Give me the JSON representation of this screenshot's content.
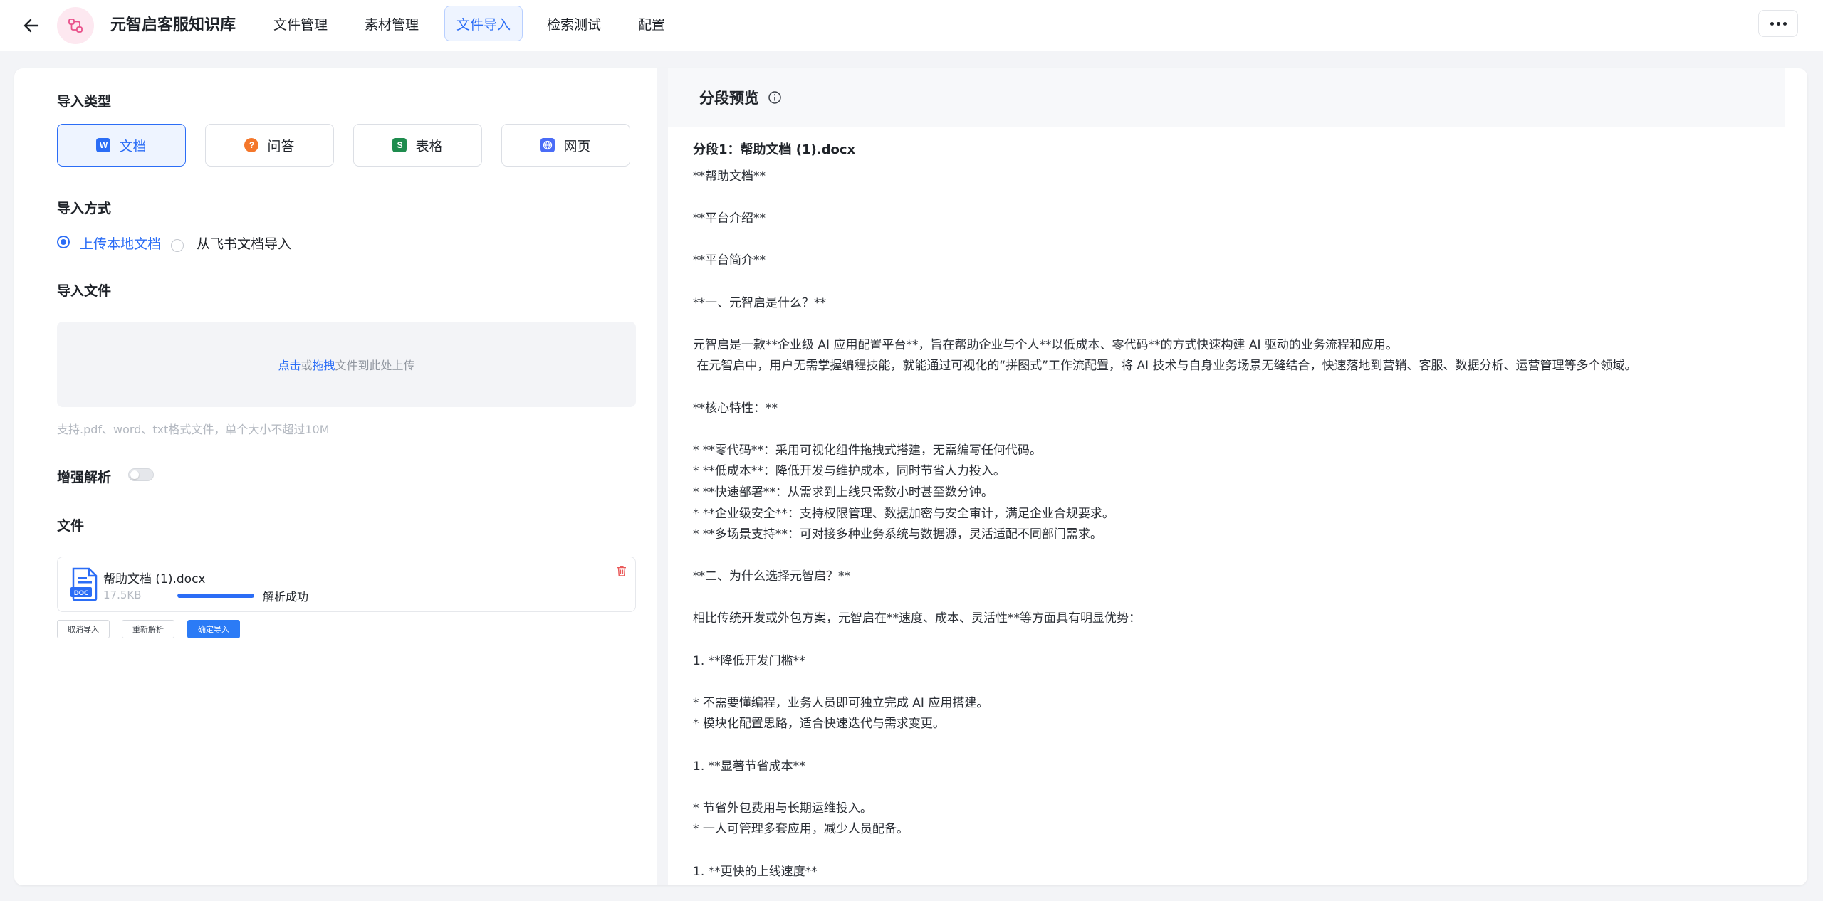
{
  "header": {
    "title": "元智启客服知识库",
    "tabs": [
      {
        "label": "文件管理"
      },
      {
        "label": "素材管理"
      },
      {
        "label": "文件导入",
        "active": true
      },
      {
        "label": "检索测试"
      },
      {
        "label": "配置"
      }
    ]
  },
  "left": {
    "import_type_label": "导入类型",
    "types": [
      {
        "label": "文档",
        "icon": "word-doc-icon",
        "color": "#2b6df6",
        "active": true
      },
      {
        "label": "问答",
        "icon": "qa-icon",
        "color": "#f4772b"
      },
      {
        "label": "表格",
        "icon": "sheet-icon",
        "color": "#1e8c4e"
      },
      {
        "label": "网页",
        "icon": "globe-icon",
        "color": "#4a6cf7"
      }
    ],
    "import_method_label": "导入方式",
    "methods": [
      {
        "label": "上传本地文档",
        "checked": true
      },
      {
        "label": "从飞书文档导入",
        "checked": false
      }
    ],
    "import_file_label": "导入文件",
    "dropzone": {
      "click": "点击",
      "or": "或",
      "drag": "拖拽",
      "rest": "文件到此处上传"
    },
    "hint": "支持.pdf、word、txt格式文件，单个大小不超过10M",
    "enhance_label": "增强解析",
    "enhance_on": false,
    "files_label": "文件",
    "file": {
      "name": "帮助文档 (1).docx",
      "size": "17.5KB",
      "progress": 1.0,
      "status": "解析成功"
    },
    "buttons": {
      "cancel": "取消导入",
      "reparse": "重新解析",
      "confirm": "确定导入"
    }
  },
  "right": {
    "title": "分段预览",
    "segment_title": "分段1：帮助文档 (1).docx",
    "lines": [
      "**帮助文档**",
      "",
      "**平台介绍**",
      "",
      "**平台简介**",
      "",
      "**一、元智启是什么？**",
      "",
      "元智启是一款**企业级 AI 应用配置平台**，旨在帮助企业与个人**以低成本、零代码**的方式快速构建 AI 驱动的业务流程和应用。",
      " 在元智启中，用户无需掌握编程技能，就能通过可视化的“拼图式”工作流配置，将 AI 技术与自身业务场景无缝结合，快速落地到营销、客服、数据分析、运营管理等多个领域。",
      "",
      "**核心特性：**",
      "",
      "* **零代码**：采用可视化组件拖拽式搭建，无需编写任何代码。",
      "* **低成本**：降低开发与维护成本，同时节省人力投入。",
      "* **快速部署**：从需求到上线只需数小时甚至数分钟。",
      "* **企业级安全**：支持权限管理、数据加密与安全审计，满足企业合规要求。",
      "* **多场景支持**：可对接多种业务系统与数据源，灵活适配不同部门需求。",
      "",
      "**二、为什么选择元智启？**",
      "",
      "相比传统开发或外包方案，元智启在**速度、成本、灵活性**等方面具有明显优势：",
      "",
      "1. **降低开发门槛**",
      "",
      "* 不需要懂编程，业务人员即可独立完成 AI 应用搭建。",
      "* 模块化配置思路，适合快速迭代与需求变更。",
      "",
      "1. **显著节省成本**",
      "",
      "* 节省外包费用与长期运维投入。",
      "* 一人可管理多套应用，减少人员配备。",
      "",
      "1. **更快的上线速度**"
    ]
  }
}
